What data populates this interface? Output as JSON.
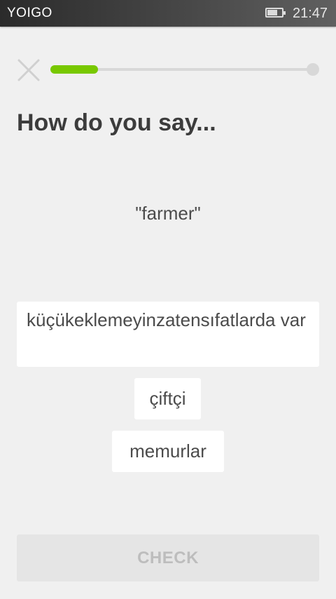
{
  "status_bar": {
    "carrier": "YOIGO",
    "time": "21:47",
    "battery_icon": "battery-icon"
  },
  "lesson": {
    "close_icon": "close-icon",
    "progress_fraction": 0.18,
    "progress_color": "#78c800",
    "prompt": "How do you say...",
    "word": "\"farmer\""
  },
  "options": [
    {
      "label": "küçükeklemeyinzatensıfatlarda var"
    },
    {
      "label": "çiftçi"
    },
    {
      "label": "memurlar"
    }
  ],
  "check_button": {
    "label": "CHECK",
    "enabled": false
  }
}
